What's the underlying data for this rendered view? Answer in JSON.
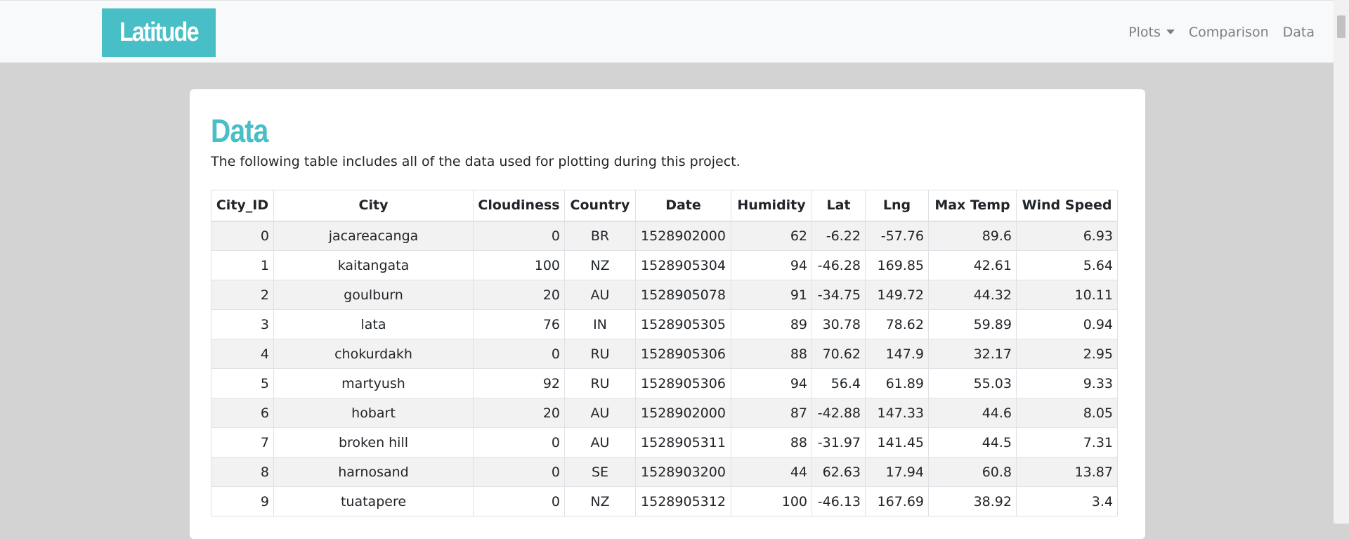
{
  "nav": {
    "brand": "Latitude",
    "links": [
      "Plots",
      "Comparison",
      "Data"
    ]
  },
  "page": {
    "title": "Data",
    "intro": "The following table includes all of the data used for plotting during this project."
  },
  "table": {
    "headers": [
      "City_ID",
      "City",
      "Cloudiness",
      "Country",
      "Date",
      "Humidity",
      "Lat",
      "Lng",
      "Max Temp",
      "Wind Speed"
    ],
    "rows": [
      [
        "0",
        "jacareacanga",
        "0",
        "BR",
        "1528902000",
        "62",
        "-6.22",
        "-57.76",
        "89.6",
        "6.93"
      ],
      [
        "1",
        "kaitangata",
        "100",
        "NZ",
        "1528905304",
        "94",
        "-46.28",
        "169.85",
        "42.61",
        "5.64"
      ],
      [
        "2",
        "goulburn",
        "20",
        "AU",
        "1528905078",
        "91",
        "-34.75",
        "149.72",
        "44.32",
        "10.11"
      ],
      [
        "3",
        "lata",
        "76",
        "IN",
        "1528905305",
        "89",
        "30.78",
        "78.62",
        "59.89",
        "0.94"
      ],
      [
        "4",
        "chokurdakh",
        "0",
        "RU",
        "1528905306",
        "88",
        "70.62",
        "147.9",
        "32.17",
        "2.95"
      ],
      [
        "5",
        "martyush",
        "92",
        "RU",
        "1528905306",
        "94",
        "56.4",
        "61.89",
        "55.03",
        "9.33"
      ],
      [
        "6",
        "hobart",
        "20",
        "AU",
        "1528902000",
        "87",
        "-42.88",
        "147.33",
        "44.6",
        "8.05"
      ],
      [
        "7",
        "broken hill",
        "0",
        "AU",
        "1528905311",
        "88",
        "-31.97",
        "141.45",
        "44.5",
        "7.31"
      ],
      [
        "8",
        "harnosand",
        "0",
        "SE",
        "1528903200",
        "44",
        "62.63",
        "17.94",
        "60.8",
        "13.87"
      ],
      [
        "9",
        "tuatapere",
        "0",
        "NZ",
        "1528905312",
        "100",
        "-46.13",
        "167.69",
        "38.92",
        "3.4"
      ]
    ]
  },
  "colors": {
    "accent": "#48bec6",
    "page_bg": "#d3d3d3",
    "navbar_bg": "#f8f9fa"
  }
}
